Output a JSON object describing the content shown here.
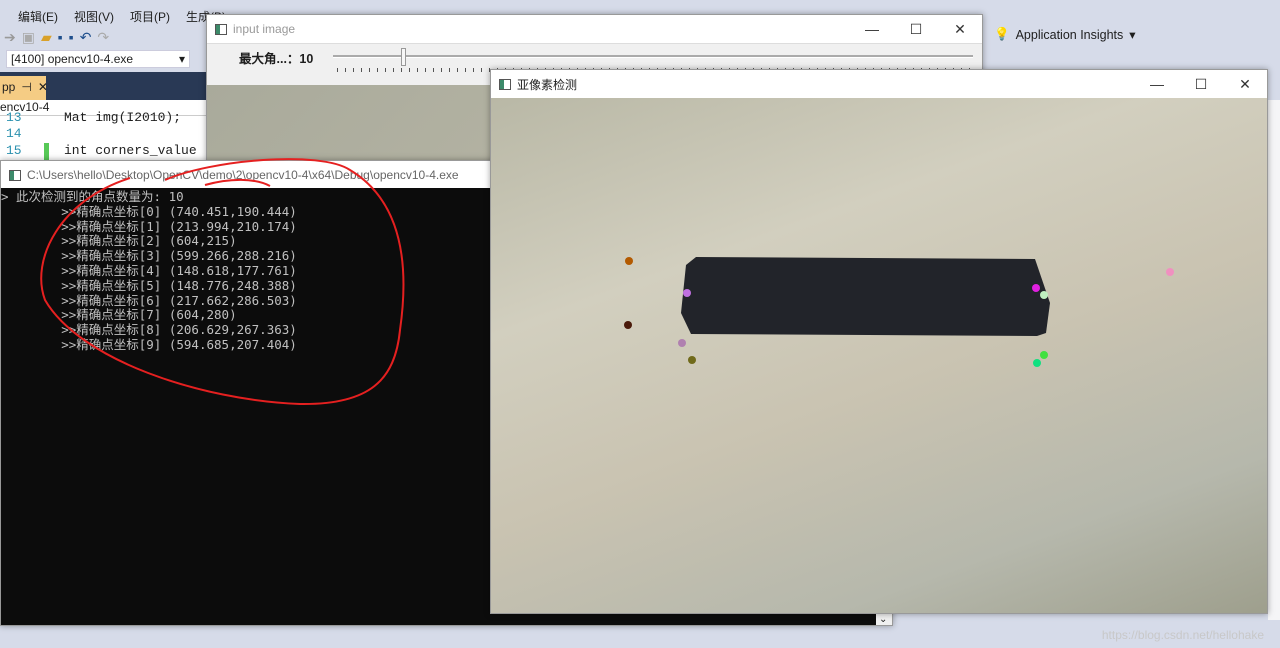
{
  "vs": {
    "menu": [
      "编辑(E)",
      "视图(V)",
      "项目(P)",
      "生成(B)"
    ],
    "process": "[4100] opencv10-4.exe",
    "doc_tab": "pp",
    "nav_project": "encv10-4",
    "code_lines": [
      {
        "num": "13",
        "text": "Mat img(I2010);"
      },
      {
        "num": "14",
        "text": ""
      },
      {
        "num": "15",
        "text": "int corners_value ="
      }
    ],
    "app_insights": "Application Insights"
  },
  "input_window": {
    "title": "input image",
    "trackbar_label": "最大角...：",
    "trackbar_value": "10",
    "trackbar_fraction": 0.11
  },
  "console": {
    "title": "C:\\Users\\hello\\Desktop\\OpenCV\\demo\\2\\opencv10-4\\x64\\Debug\\opencv10-4.exe",
    "lines": [
      "> 此次检测到的角点数量为: 10",
      "        >>精确点坐标[0] (740.451,190.444)",
      "        >>精确点坐标[1] (213.994,210.174)",
      "        >>精确点坐标[2] (604,215)",
      "        >>精确点坐标[3] (599.266,288.216)",
      "        >>精确点坐标[4] (148.618,177.761)",
      "        >>精确点坐标[5] (148.776,248.388)",
      "        >>精确点坐标[6] (217.662,286.503)",
      "        >>精确点坐标[7] (604,280)",
      "        >>精确点坐标[8] (206.629,267.363)",
      "        >>精确点坐标[9] (594.685,207.404)"
    ]
  },
  "subpixel_window": {
    "title": "亚像素检测"
  },
  "window_controls": {
    "minimize": "—",
    "maximize": "☐",
    "close": "✕"
  },
  "watermark": "https://blog.csdn.net/hellohake",
  "annotation_color": "#e52020"
}
